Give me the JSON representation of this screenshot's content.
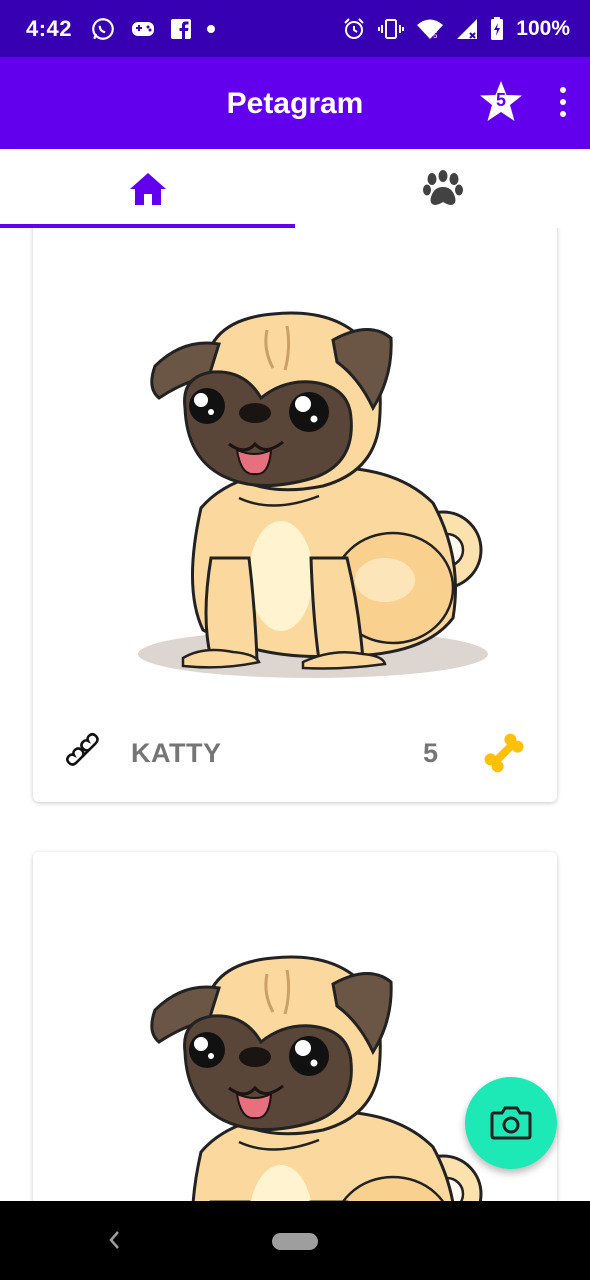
{
  "status_bar": {
    "time": "4:42",
    "battery": "100%",
    "left_icons": [
      "whatsapp-icon",
      "gamepad-icon",
      "facebook-icon",
      "dot-icon"
    ],
    "right_icons": [
      "alarm-icon",
      "vibrate-icon",
      "wifi-icon",
      "signal-icon",
      "battery-icon"
    ]
  },
  "app_bar": {
    "title": "Petagram",
    "favorites_count": "5"
  },
  "tabs": [
    {
      "icon": "home-icon",
      "selected": true
    },
    {
      "icon": "paw-icon",
      "selected": false
    }
  ],
  "pets": [
    {
      "name": "KATTY",
      "likes": "5",
      "image": "pug-illustration"
    },
    {
      "name": "",
      "likes": "",
      "image": "pug-illustration"
    }
  ],
  "fab": {
    "icon": "camera-icon"
  },
  "colors": {
    "status_bar": "#3700b3",
    "primary": "#6200ee",
    "accent": "#1de9b6",
    "bone_filled": "#ffc107",
    "text_secondary": "#757575"
  }
}
